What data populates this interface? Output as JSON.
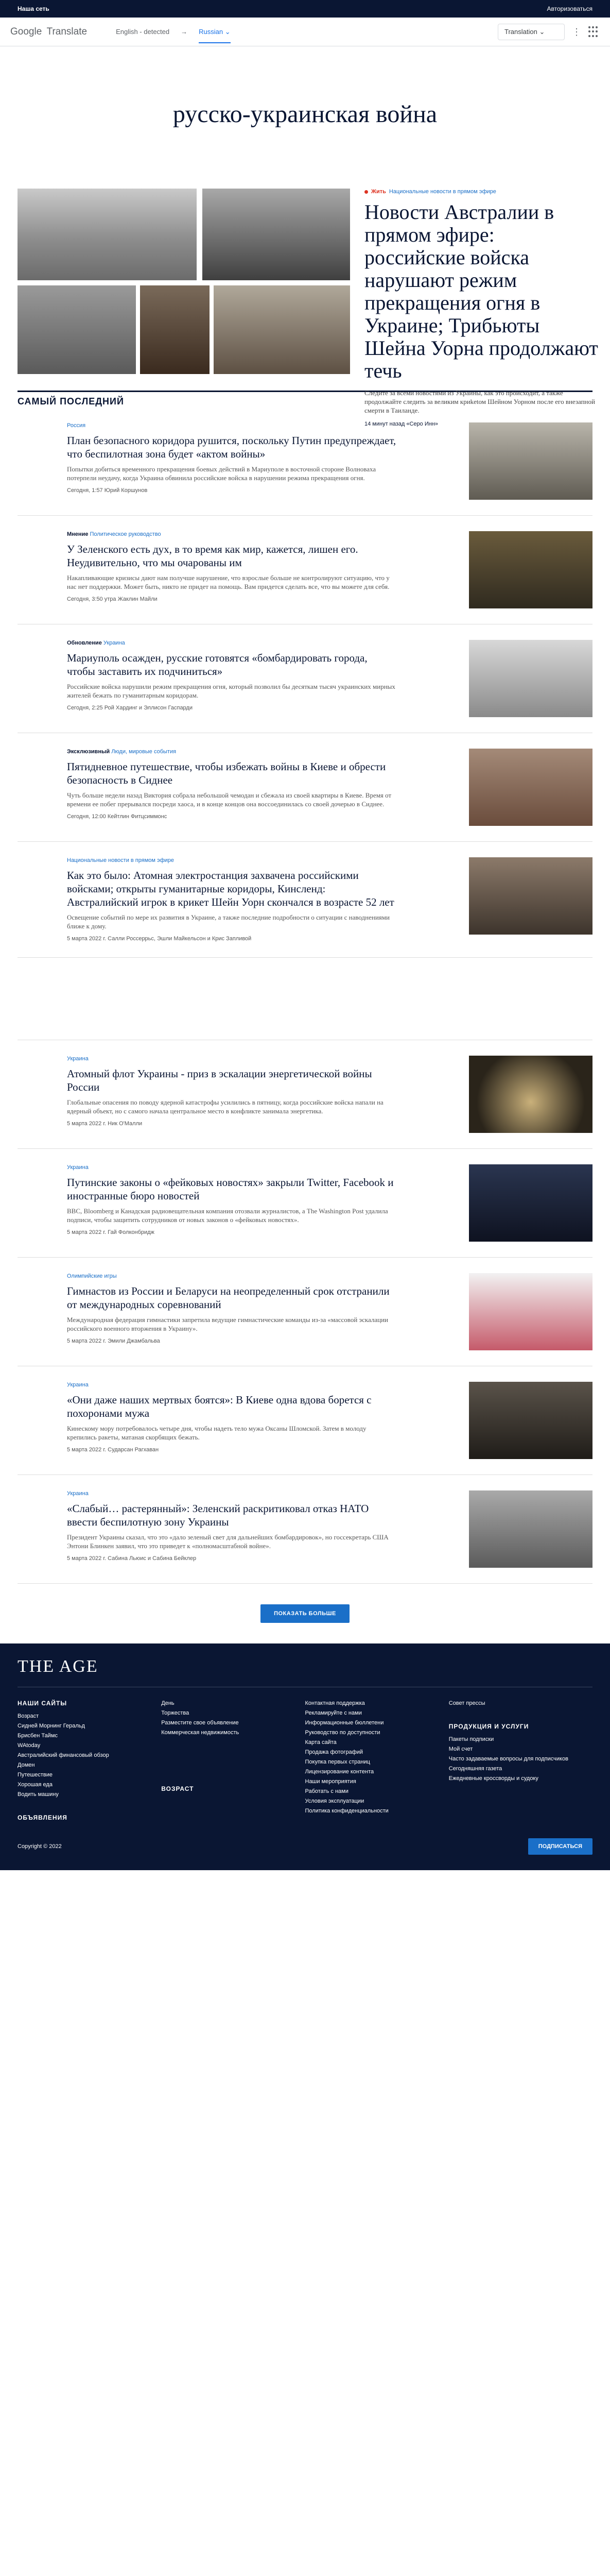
{
  "topbar": {
    "left": "Наша сеть",
    "right": "Авторизоваться"
  },
  "translate": {
    "logo_google": "Google",
    "logo_translate": "Translate",
    "source_lang": "English - detected",
    "target_lang": "Russian",
    "mode": "Translation"
  },
  "tag_title": "русско-украинская война",
  "hero": {
    "kicker_live": "Жить",
    "kicker_section": "Национальные новости в прямом эфире",
    "headline": "Новости Австралии в прямом эфире: российские войска нарушают режим прекращения огня в Украине; Трибьюты Шейна Уорна продолжают течь",
    "summary": "Следите за всеми новостями из Украины, как это происходит, а также продолжайте следить за великим криketом Шейном Уорном после его внезапной смерти в Таиланде.",
    "meta": "14 минут назад  «Серо Инн»"
  },
  "section_title": "САМЫЙ ПОСЛЕДНИЙ",
  "latest": [
    {
      "kicker": "Россия",
      "kicker_b": "",
      "headline": "План безопасного коридора рушится, поскольку Путин предупреждает, что беспилотная зона будет «актом войны»",
      "summary": "Попытки добиться временного прекращения боевых действий в Мариуполе в восточной стороне Волноваха потерпели неудачу, когда Украина обвинила российские войска в нарушении режима прекращения огня.",
      "meta": "Сегодня, 1:57  Юрий Коршунов"
    },
    {
      "kicker": "Политическое руководство",
      "kicker_b": "Мнение",
      "headline": "У Зеленского есть дух, в то время как мир, кажется, лишен его. Неудивительно, что мы очарованы им",
      "summary": "Накапливающие кризисы дают нам получше нарушение, что взрослые больше не контролируют ситуацию, что у нас нет поддержки. Может быть, никто не придет на помощь. Вам придется сделать все, что вы можете для себя.",
      "meta": "Сегодня, 3:50 утра  Жаклин Майли"
    },
    {
      "kicker": "Украина",
      "kicker_b": "Обновление",
      "headline": "Мариуполь осажден, русские готовятся «бомбардировать города, чтобы заставить их подчиниться»",
      "summary": "Российские войска нарушили режим прекращения огня, который позволил бы десяткам тысяч украинских мирных жителей бежать по гуманитарным коридорам.",
      "meta": "Сегодня, 2:25  Рой Хардинг и Эллисон Гаспарди"
    },
    {
      "kicker": "Люди, мировые события",
      "kicker_b": "Эксклюзивный",
      "headline": "Пятидневное путешествие, чтобы избежать войны в Киеве и обрести безопасность в Сиднее",
      "summary": "Чуть больше недели назад Виктория собрала небольшой чемодан и сбежала из своей квартиры в Киеве. Время от времени ее побег прерывался посреди хаоса, и в конце концов она воссоединилась со своей дочерью в Сиднее.",
      "meta": "Сегодня, 12:00  Кейтлин Фитцсиммонс"
    },
    {
      "kicker": "Национальные новости в прямом эфире",
      "kicker_b": "",
      "headline": "Как это было: Атомная электростанция захвачена российскими войсками; открыты гуманитарные коридоры, Кинсленд: Австралийский игрок в крикет Шейн Уорн скончался в возрасте 52 лет",
      "summary": "Освещение событий по мере их развития в Украине, а также последние подробности о ситуации с наводнениями ближе к дому.",
      "meta": "5 марта 2022 г.  Салли Россеррьс, Эшли Майкельсон и Крис Запливой"
    }
  ],
  "more_list": [
    {
      "kicker": "Украина",
      "headline": "Атомный флот Украины - приз в эскалации энергетической войны России",
      "summary": "Глобальные опасения по поводу ядерной катастрофы усилились в пятницу, когда российские войска напали на ядерный объект, но с самого начала центральное место в конфликте занимала энергетика.",
      "meta": "5 марта 2022 г.  Ник О'Малли"
    },
    {
      "kicker": "Украина",
      "headline": "Путинские законы о «фейковых новостях» закрыли Twitter, Facebook и иностранные бюро новостей",
      "summary": "BBC, Bloomberg и Канадская радиовещательная компания отозвали журналистов, а The Washington Post удалила подписи, чтобы защитить сотрудников от новых законов о «фейковых новостях».",
      "meta": "5 марта 2022 г.  Гай Фолконбридж"
    },
    {
      "kicker": "Олимпийские игры",
      "headline": "Гимнастов из России и Беларуси на неопределенный срок отстранили от международных соревнований",
      "summary": "Международная федерация гимнастики запретила ведущие гимнастические команды из-за «массовой эскалации российского военного вторжения в Украину».",
      "meta": "5 марта 2022 г.  Эмили Джамбальва"
    },
    {
      "kicker": "Украина",
      "headline": "«Они даже наших мертвых боятся»: В Киеве одна вдова борется с похоронами мужа",
      "summary": "Кинескому мору потребовалось четыре дня, чтобы надеть тело мужа Оксаны Шломской. Затем в молоду крепились ракеты, матаная скорбящих бежать.",
      "meta": "5 марта 2022 г.  Сударсан Рагхаван"
    },
    {
      "kicker": "Украина",
      "headline": "«Слабый… растерянный»: Зеленский раскритиковал отказ НАТО ввести беспилотную зону Украины",
      "summary": "Президент Украины сказал, что это «дало зеленый свет для дальнейших бомбардировок», но госсекретарь США Энтони Блинкен заявил, что это приведет к «полномасштабной войне».",
      "meta": "5 марта 2022 г.  Сабина Льюис и Сабина Бейклер"
    }
  ],
  "more_button": "ПОКАЗАТЬ БОЛЬШЕ",
  "footer": {
    "logo": "THE AGE",
    "col1_title": "НАШИ САЙТЫ",
    "col1": [
      "Возраст",
      "Сидней Морнинг Геральд",
      "Брисбен Таймс",
      "WAtoday",
      "Австралийский финансовый обзор",
      "Домен",
      "Путешествие",
      "Хорошая еда",
      "Водить машину"
    ],
    "col1b_title": "ОБЪЯВЛЕНИЯ",
    "col2": [
      "День",
      "Торжества",
      "Разместите свое объявление",
      "Коммерческая недвижимость"
    ],
    "col2b_title": "ВОЗРАСТ",
    "col3": [
      "Контактная поддержка",
      "Рекламируйте с нами",
      "Информационные бюллетени",
      "Руководство по доступности",
      "Карта сайта",
      "Продажа фотографий",
      "Покупка первых страниц",
      "Лицензирование контента",
      "Наши мероприятия",
      "Работать с нами",
      "Условия эксплуатации",
      "Политика конфиденциальности"
    ],
    "col4a": [
      "Совет прессы"
    ],
    "col4_title": "ПРОДУКЦИЯ И УСЛУГИ",
    "col4": [
      "Пакеты подписки",
      "Мой счет",
      "Часто задаваемые вопросы для подписчиков",
      "Сегодняшняя газета",
      "Ежедневные кроссворды и судоку"
    ],
    "copyright": "Copyright © 2022",
    "subscribe": "ПОДПИСАТЬСЯ"
  }
}
